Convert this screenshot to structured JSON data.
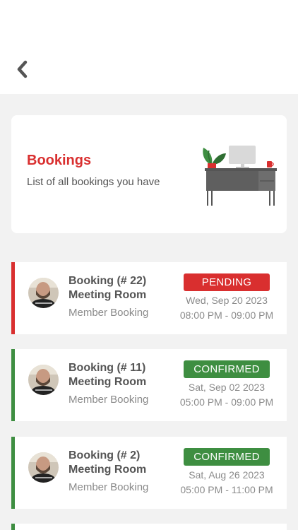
{
  "header": {
    "title": "Bookings",
    "subtitle": "List of all bookings you have"
  },
  "bookings": [
    {
      "title": "Booking (# 22)",
      "room": "Meeting Room",
      "type": "Member Booking",
      "status": "PENDING",
      "date": "Wed, Sep 20 2023",
      "time": "08:00 PM - 09:00 PM"
    },
    {
      "title": "Booking (# 11)",
      "room": "Meeting Room",
      "type": "Member Booking",
      "status": "CONFIRMED",
      "date": "Sat, Sep 02 2023",
      "time": "05:00 PM - 09:00 PM"
    },
    {
      "title": "Booking (# 2)",
      "room": "Meeting Room",
      "type": "Member Booking",
      "status": "CONFIRMED",
      "date": "Sat, Aug 26 2023",
      "time": "05:00 PM - 11:00 PM"
    }
  ],
  "colors": {
    "pending": "#d92f2f",
    "confirmed": "#3e8e41",
    "accent": "#d92f2f"
  },
  "icons": {
    "back": "chevron-left-icon",
    "illustration": "desk-computer-illustration",
    "avatar": "avatar-photo"
  }
}
